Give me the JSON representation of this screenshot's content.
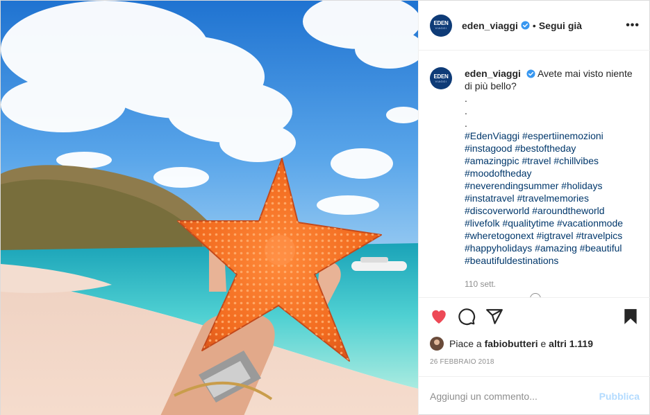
{
  "header": {
    "username": "eden_viaggi",
    "separator": "•",
    "follow_label": "Segui già",
    "more_label": "•••",
    "avatar_logo": "EDEN",
    "avatar_sub": "VIAGGI"
  },
  "caption": {
    "username": "eden_viaggi",
    "text": "Avete mai visto niente di più bello?",
    "dots": [
      ".",
      ".",
      "."
    ],
    "hashtag_lines": [
      "#EdenViaggi #espertiinemozioni",
      "#instagood #bestoftheday",
      "#amazingpic #travel #chillvibes",
      "#moodoftheday",
      "#neverendingsummer #holidays",
      "#instatravel #travelmemories",
      "#discoverworld #aroundtheworld",
      "#livefolk #qualitytime #vacationmode",
      "#wheretogonext #igtravel #travelpics",
      "#happyholidays #amazing #beautiful",
      "#beautifuldestinations"
    ],
    "time": "110 sett."
  },
  "actions": {
    "icons": [
      "heart-icon",
      "comment-icon",
      "share-icon",
      "bookmark-icon"
    ],
    "liked": true,
    "saved": true
  },
  "likes": {
    "prefix": "Piace a",
    "user": "fabiobutteri",
    "conjunction": "e",
    "others": "altri 1.119"
  },
  "date": "26 FEBBRAIO 2018",
  "comment_box": {
    "placeholder": "Aggiungi un commento...",
    "publish_label": "Pubblica"
  },
  "colors": {
    "heart": "#ed4956",
    "hashtag": "#00376b",
    "verified": "#3897f0",
    "publish_disabled": "#b3dbff",
    "secondary_text": "#8e8e8e"
  }
}
